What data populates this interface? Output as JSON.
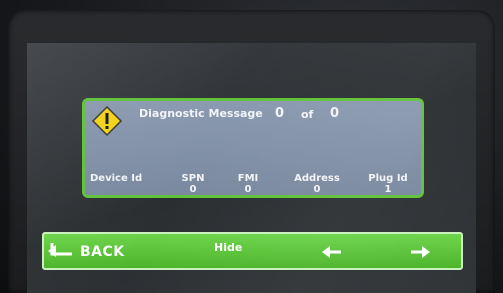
{
  "diagnostic": {
    "title": "Diagnostic Message",
    "current": "0",
    "of_label": "of",
    "total": "0",
    "icon": "warning-icon"
  },
  "columns": {
    "device_id": {
      "label": "Device Id",
      "value": ""
    },
    "spn": {
      "label": "SPN",
      "value": "0"
    },
    "fmi": {
      "label": "FMI",
      "value": "0"
    },
    "address": {
      "label": "Address",
      "value": "0"
    },
    "plug_id": {
      "label": "Plug Id",
      "value": "1"
    }
  },
  "toolbar": {
    "back_label": "BACK",
    "hide_label": "Hide",
    "prev_icon": "arrow-left-icon",
    "next_icon": "arrow-right-icon"
  },
  "colors": {
    "panel_border": "#5fc23c",
    "panel_fill": "#8b9ab0",
    "toolbar_fill": "#5cc43a",
    "warning_fill": "#f2d21b"
  }
}
